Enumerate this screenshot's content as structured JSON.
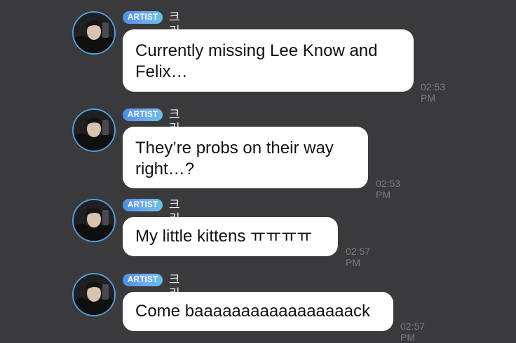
{
  "messages": [
    {
      "badge": "ARTIST",
      "name": "크리스",
      "text": "Currently missing Lee Know and\nFelix…",
      "time": "02:53 PM"
    },
    {
      "badge": "ARTIST",
      "name": "크리스",
      "text": "They’re probs on their way\nright…?",
      "time": "02:53 PM"
    },
    {
      "badge": "ARTIST",
      "name": "크리스",
      "text": "My little kittens ㅠㅠㅠㅠ",
      "time": "02:57 PM"
    },
    {
      "badge": "ARTIST",
      "name": "크리스",
      "text": "Come baaaaaaaaaaaaaaaaack",
      "time": "02:57 PM"
    }
  ],
  "colors": {
    "background": "#3a3a3c",
    "bubble": "#ffffff",
    "badge_start": "#4b8fe8",
    "badge_end": "#63c3e6",
    "timestamp": "#7d7d80",
    "avatar_ring": "#4e9fd9"
  }
}
